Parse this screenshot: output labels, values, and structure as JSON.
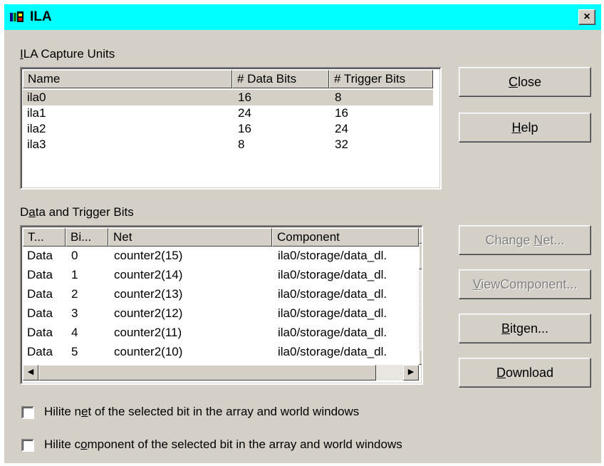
{
  "window": {
    "title": "ILA",
    "close_glyph": "×"
  },
  "capture_units": {
    "group_label_prefix": "",
    "group_label_underline": "I",
    "group_label_rest": "LA Capture Units",
    "columns": [
      "Name",
      "# Data Bits",
      "# Trigger Bits"
    ],
    "rows": [
      {
        "name": "ila0",
        "data_bits": "16",
        "trigger_bits": "8",
        "selected": true
      },
      {
        "name": "ila1",
        "data_bits": "24",
        "trigger_bits": "16",
        "selected": false
      },
      {
        "name": "ila2",
        "data_bits": "16",
        "trigger_bits": "24",
        "selected": false
      },
      {
        "name": "ila3",
        "data_bits": "8",
        "trigger_bits": "32",
        "selected": false
      }
    ]
  },
  "bits": {
    "group_label_prefix": "D",
    "group_label_underline": "a",
    "group_label_rest": "ta and Trigger Bits",
    "columns": [
      "T...",
      "Bi...",
      "Net",
      "Component"
    ],
    "rows": [
      {
        "type": "Data",
        "bit": "0",
        "net": "counter2(15)",
        "component": "ila0/storage/data_dl."
      },
      {
        "type": "Data",
        "bit": "1",
        "net": "counter2(14)",
        "component": "ila0/storage/data_dl."
      },
      {
        "type": "Data",
        "bit": "2",
        "net": "counter2(13)",
        "component": "ila0/storage/data_dl."
      },
      {
        "type": "Data",
        "bit": "3",
        "net": "counter2(12)",
        "component": "ila0/storage/data_dl."
      },
      {
        "type": "Data",
        "bit": "4",
        "net": "counter2(11)",
        "component": "ila0/storage/data_dl."
      },
      {
        "type": "Data",
        "bit": "5",
        "net": "counter2(10)",
        "component": "ila0/storage/data_dl."
      }
    ]
  },
  "buttons": {
    "close": {
      "u": "C",
      "rest": "lose",
      "pre": ""
    },
    "help": {
      "u": "H",
      "rest": "elp",
      "pre": ""
    },
    "change_net": {
      "pre": "Change ",
      "u": "N",
      "rest": "et..."
    },
    "view_component": {
      "pre": "",
      "u": "V",
      "rest": "iewComponent..."
    },
    "bitgen": {
      "pre": "",
      "u": "B",
      "rest": "itgen..."
    },
    "download": {
      "pre": "",
      "u": "D",
      "rest": "ownload"
    }
  },
  "checkboxes": {
    "hilite_net": {
      "pre": "Hilite n",
      "u": "e",
      "rest": "t of the selected bit in the array and world windows",
      "checked": false
    },
    "hilite_component": {
      "pre": "Hilite c",
      "u": "o",
      "rest": "mponent of the selected bit in the array and world windows",
      "checked": false
    }
  },
  "icons": {
    "title": "ila-app-icon",
    "scroll_up": "▲",
    "scroll_down": "▼",
    "scroll_left": "◀",
    "scroll_right": "▶"
  }
}
